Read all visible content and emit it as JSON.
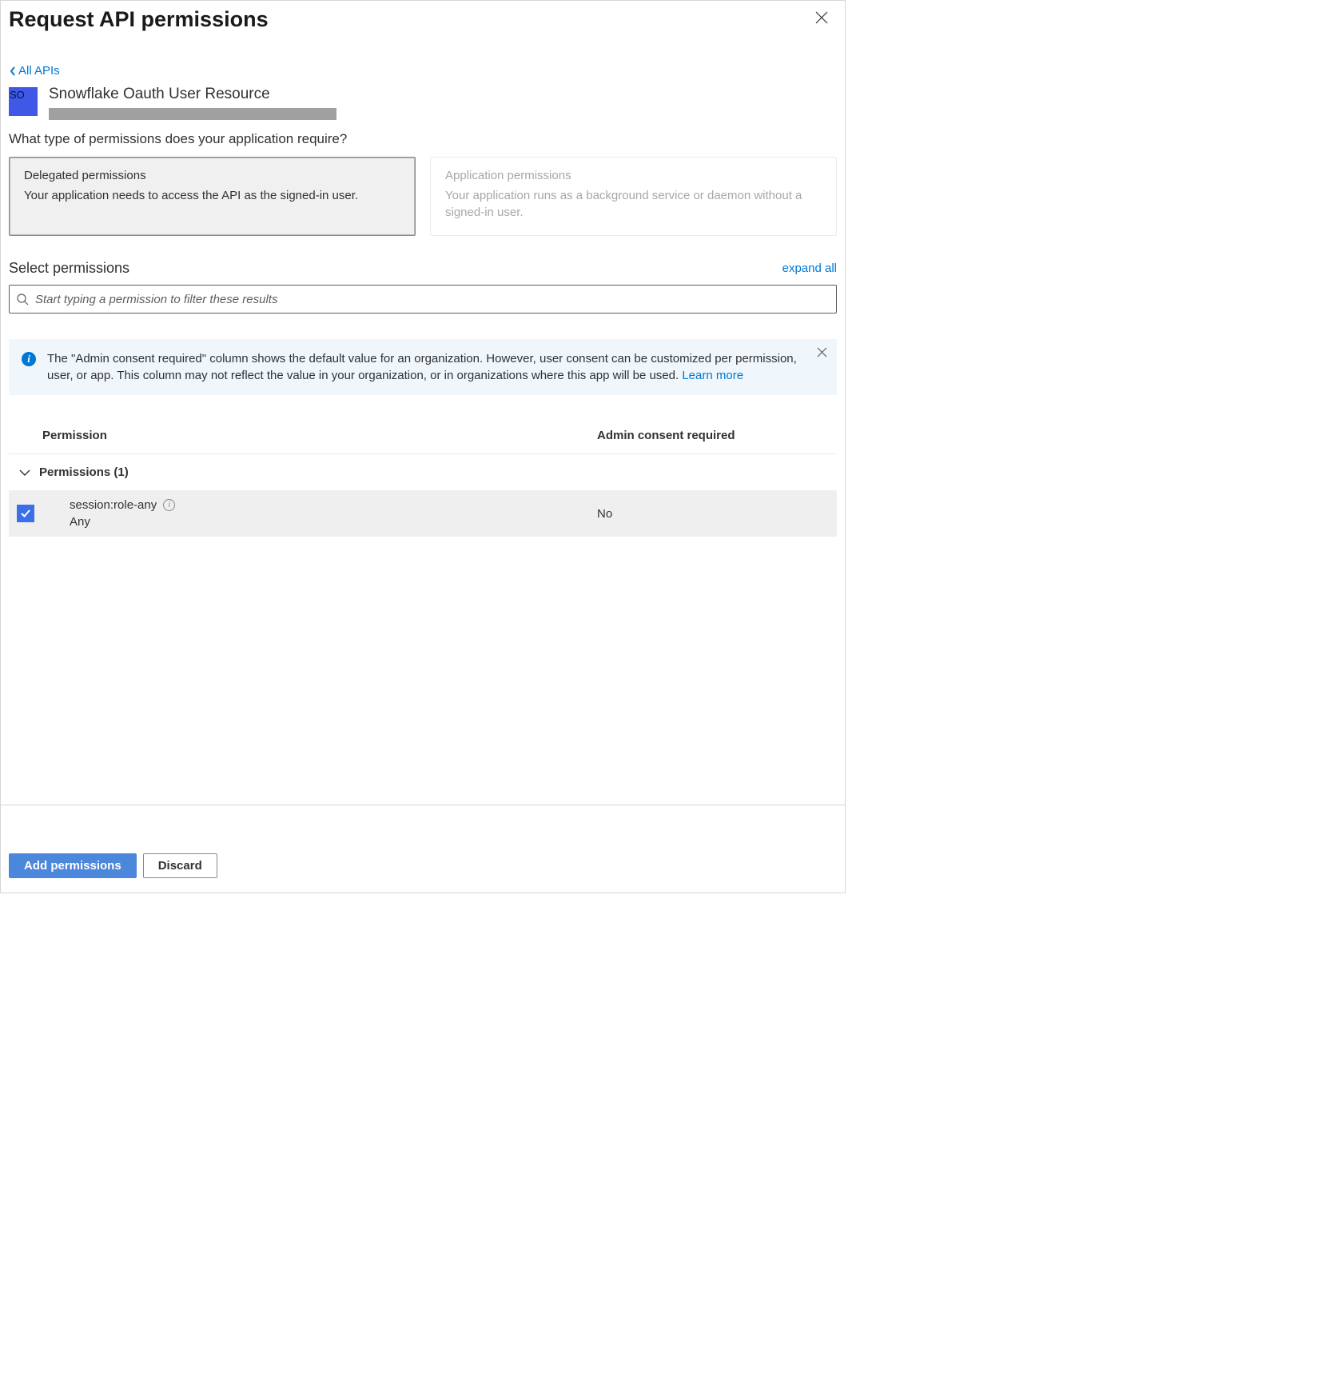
{
  "header": {
    "title": "Request API permissions"
  },
  "back": {
    "label": "All APIs"
  },
  "resource": {
    "avatar": "SO",
    "name": "Snowflake Oauth User Resource"
  },
  "question": "What type of permissions does your application require?",
  "permTypes": {
    "delegated": {
      "title": "Delegated permissions",
      "desc": "Your application needs to access the API as the signed-in user."
    },
    "application": {
      "title": "Application permissions",
      "desc": "Your application runs as a background service or daemon without a signed-in user."
    }
  },
  "select": {
    "heading": "Select permissions",
    "expand": "expand all"
  },
  "search": {
    "placeholder": "Start typing a permission to filter these results"
  },
  "info": {
    "text": "The \"Admin consent required\" column shows the default value for an organization. However, user consent can be customized per permission, user, or app. This column may not reflect the value in your organization, or in organizations where this app will be used.  ",
    "learn": "Learn more"
  },
  "table": {
    "col1": "Permission",
    "col2": "Admin consent required"
  },
  "group": {
    "label": "Permissions (1)"
  },
  "permRow": {
    "name": "session:role-any",
    "desc": "Any",
    "consent": "No"
  },
  "footer": {
    "add": "Add permissions",
    "discard": "Discard"
  }
}
